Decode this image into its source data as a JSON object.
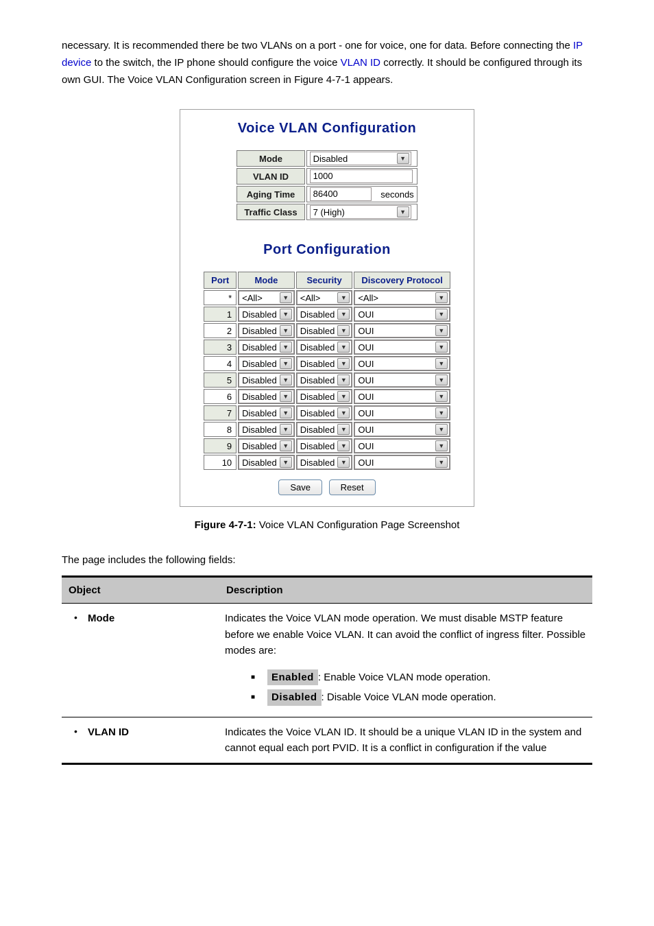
{
  "intro_line1": "necessary. It is recommended there be two VLANs on a port - one for voice, one for data. Before connecting the",
  "intro_link": "IP device",
  "intro_line2": " to the switch, the IP phone should configure the voice ",
  "intro_link2": "VLAN ID",
  "intro_line3": " correctly. It should be configured through its own GUI. The Voice VLAN Configuration screen in ",
  "intro_fig": "Figure 4-7-1",
  "intro_end": " appears.",
  "panel": {
    "title1": "Voice VLAN Configuration",
    "title2": "Port Configuration",
    "global": {
      "mode_label": "Mode",
      "mode_value": "Disabled",
      "vlan_label": "VLAN ID",
      "vlan_value": "1000",
      "aging_label": "Aging Time",
      "aging_value": "86400",
      "aging_unit": "seconds",
      "tc_label": "Traffic Class",
      "tc_value": "7 (High)"
    },
    "headers": {
      "port": "Port",
      "mode": "Mode",
      "security": "Security",
      "dp": "Discovery Protocol"
    },
    "rows": [
      {
        "port": "*",
        "mode": "<All>",
        "sec": "<All>",
        "dp": "<All>"
      },
      {
        "port": "1",
        "mode": "Disabled",
        "sec": "Disabled",
        "dp": "OUI"
      },
      {
        "port": "2",
        "mode": "Disabled",
        "sec": "Disabled",
        "dp": "OUI"
      },
      {
        "port": "3",
        "mode": "Disabled",
        "sec": "Disabled",
        "dp": "OUI"
      },
      {
        "port": "4",
        "mode": "Disabled",
        "sec": "Disabled",
        "dp": "OUI"
      },
      {
        "port": "5",
        "mode": "Disabled",
        "sec": "Disabled",
        "dp": "OUI"
      },
      {
        "port": "6",
        "mode": "Disabled",
        "sec": "Disabled",
        "dp": "OUI"
      },
      {
        "port": "7",
        "mode": "Disabled",
        "sec": "Disabled",
        "dp": "OUI"
      },
      {
        "port": "8",
        "mode": "Disabled",
        "sec": "Disabled",
        "dp": "OUI"
      },
      {
        "port": "9",
        "mode": "Disabled",
        "sec": "Disabled",
        "dp": "OUI"
      },
      {
        "port": "10",
        "mode": "Disabled",
        "sec": "Disabled",
        "dp": "OUI"
      }
    ],
    "save": "Save",
    "reset": "Reset"
  },
  "figure_caption_a": "Figure 4-7-1:",
  "figure_caption_b": " Voice VLAN Configuration Page Screenshot",
  "desc_lead": "The page includes the following fields:",
  "dtable": {
    "h1": "Object",
    "h2": "Description",
    "row1_obj": "Mode",
    "row1_d1": "Indicates the Voice VLAN mode operation. We must disable MSTP feature before we enable Voice VLAN. It can avoid the conflict of ingress filter. Possible modes are:",
    "row1_chip1": "Enabled",
    "row1_chip1_tail": ": Enable Voice VLAN mode operation.",
    "row1_chip2": "Disabled",
    "row1_chip2_tail": ": Disable Voice VLAN mode operation.",
    "row2_obj": "VLAN ID",
    "row2_d": "Indicates the Voice VLAN ID. It should be a unique VLAN ID in the system and cannot equal each port PVID. It is a conflict in configuration if the value"
  }
}
